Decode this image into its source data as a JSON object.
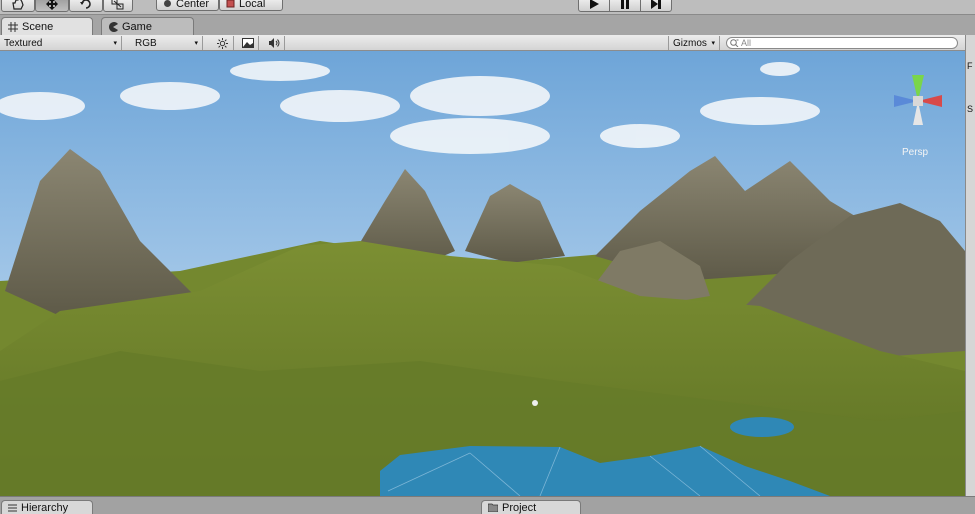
{
  "toolbar": {
    "tools": [
      {
        "icon": "hand-icon",
        "active": false
      },
      {
        "icon": "move-icon",
        "active": true
      },
      {
        "icon": "rotate-icon",
        "active": false
      },
      {
        "icon": "scale-icon",
        "active": false
      }
    ],
    "pivot_label": "Center",
    "space_label": "Local",
    "play_icons": [
      "play-icon",
      "pause-icon",
      "step-icon"
    ]
  },
  "tabs": [
    {
      "label": "Scene",
      "icon": "grid-icon",
      "active": true
    },
    {
      "label": "Game",
      "icon": "pacman-icon",
      "active": false
    }
  ],
  "scene_toolbar": {
    "draw_mode": "Textured",
    "render_mode": "RGB",
    "lighting_icon": "sun-icon",
    "fx_icon": "image-icon",
    "audio_icon": "speaker-icon",
    "gizmos_label": "Gizmos",
    "search_placeholder": "All"
  },
  "viewport": {
    "gizmo_label": "Persp",
    "colors": {
      "sky_top": "#6ea5d8",
      "grass": "#6b7f2a",
      "water": "#2f88b6",
      "rock": "#77715f"
    }
  },
  "bottom_tabs": [
    {
      "label": "Hierarchy"
    },
    {
      "label": "Project",
      "icon": "folder-icon"
    }
  ],
  "right_panel_letters": [
    "F",
    "S"
  ]
}
